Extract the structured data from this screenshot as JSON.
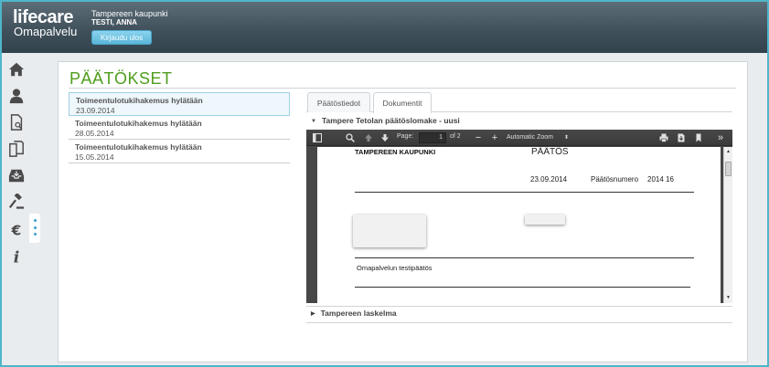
{
  "header": {
    "logo_main": "lifecare",
    "logo_sub": "Omapalvelu",
    "organization": "Tampereen kaupunki",
    "user_name": "TESTI, ANNA",
    "logout_label": "Kirjaudu ulos"
  },
  "sidebar": {
    "items": [
      {
        "icon": "home-icon"
      },
      {
        "icon": "person-icon"
      },
      {
        "icon": "document-search-icon"
      },
      {
        "icon": "documents-icon"
      },
      {
        "icon": "inbox-icon"
      },
      {
        "icon": "gavel-icon"
      },
      {
        "icon": "euro-icon"
      },
      {
        "icon": "info-icon"
      }
    ],
    "active_item": "euro-icon"
  },
  "main": {
    "title": "PÄÄTÖKSET",
    "decisions": [
      {
        "title": "Toimeentulotukihakemus hylätään",
        "date": "23.09.2014",
        "selected": true
      },
      {
        "title": "Toimeentulotukihakemus hylätään",
        "date": "28.05.2014",
        "selected": false
      },
      {
        "title": "Toimeentulotukihakemus hylätään",
        "date": "15.05.2014",
        "selected": false
      }
    ],
    "tabs": [
      {
        "label": "Päätöstiedot",
        "active": false
      },
      {
        "label": "Dokumentit",
        "active": true
      }
    ],
    "sections": [
      {
        "label": "Tampere Tetolan päätöslomake - uusi",
        "expanded": true
      },
      {
        "label": "Tampereen laskelma",
        "expanded": false
      }
    ]
  },
  "viewer": {
    "page_label": "Page:",
    "page_current": "1",
    "page_total": "of 2",
    "zoom": "Automatic Zoom",
    "document": {
      "organization": "TAMPEREEN KAUPUNKI",
      "doc_type": "PÄÄTÖS",
      "date": "23.09.2014",
      "number_label": "Päätösnumero",
      "number": "2014 16",
      "body_text": "Omapalvelun testipäätös"
    }
  },
  "colors": {
    "accent_green": "#4e9d1c",
    "accent_blue": "#5ab6d8",
    "frame": "#4fb6c8",
    "header_dark": "#3f4f5a"
  }
}
